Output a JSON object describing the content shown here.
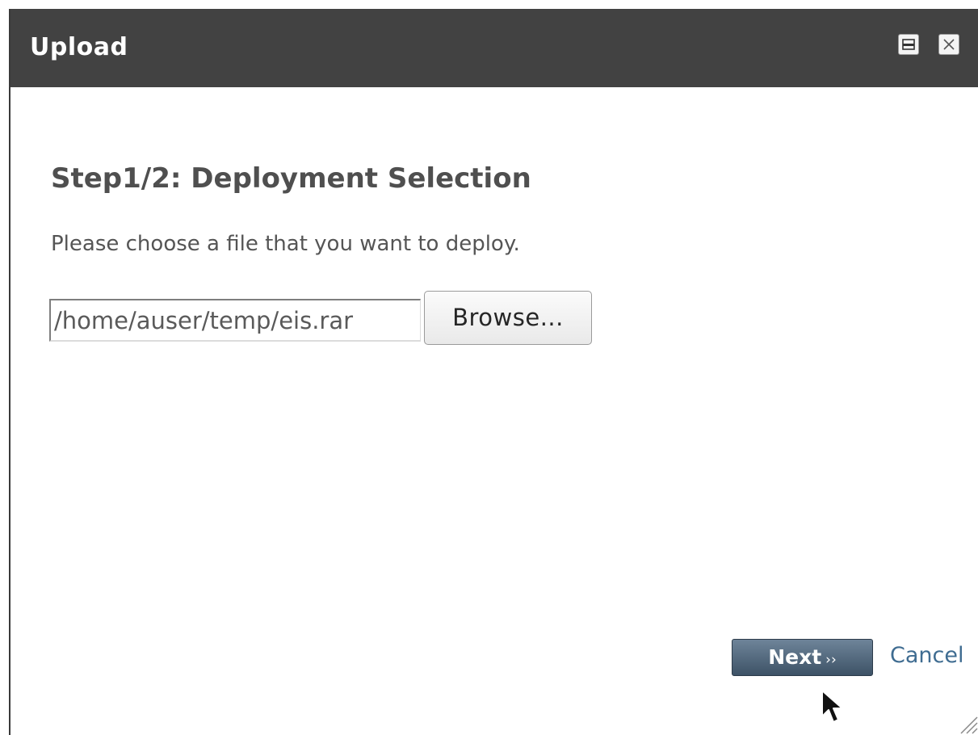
{
  "window": {
    "title": "Upload"
  },
  "wizard": {
    "heading": "Step1/2: Deployment Selection",
    "description": "Please choose a file that you want to deploy.",
    "file_value": "/home/auser/temp/eis.rar",
    "browse_label": "Browse..."
  },
  "footer": {
    "next_label": "Next",
    "next_arrows": "››",
    "cancel_label": "Cancel"
  },
  "icons": {
    "minimize": "minimize-icon",
    "close": "close-icon",
    "cursor": "mouse-pointer-icon",
    "resize": "resize-grip-icon"
  }
}
